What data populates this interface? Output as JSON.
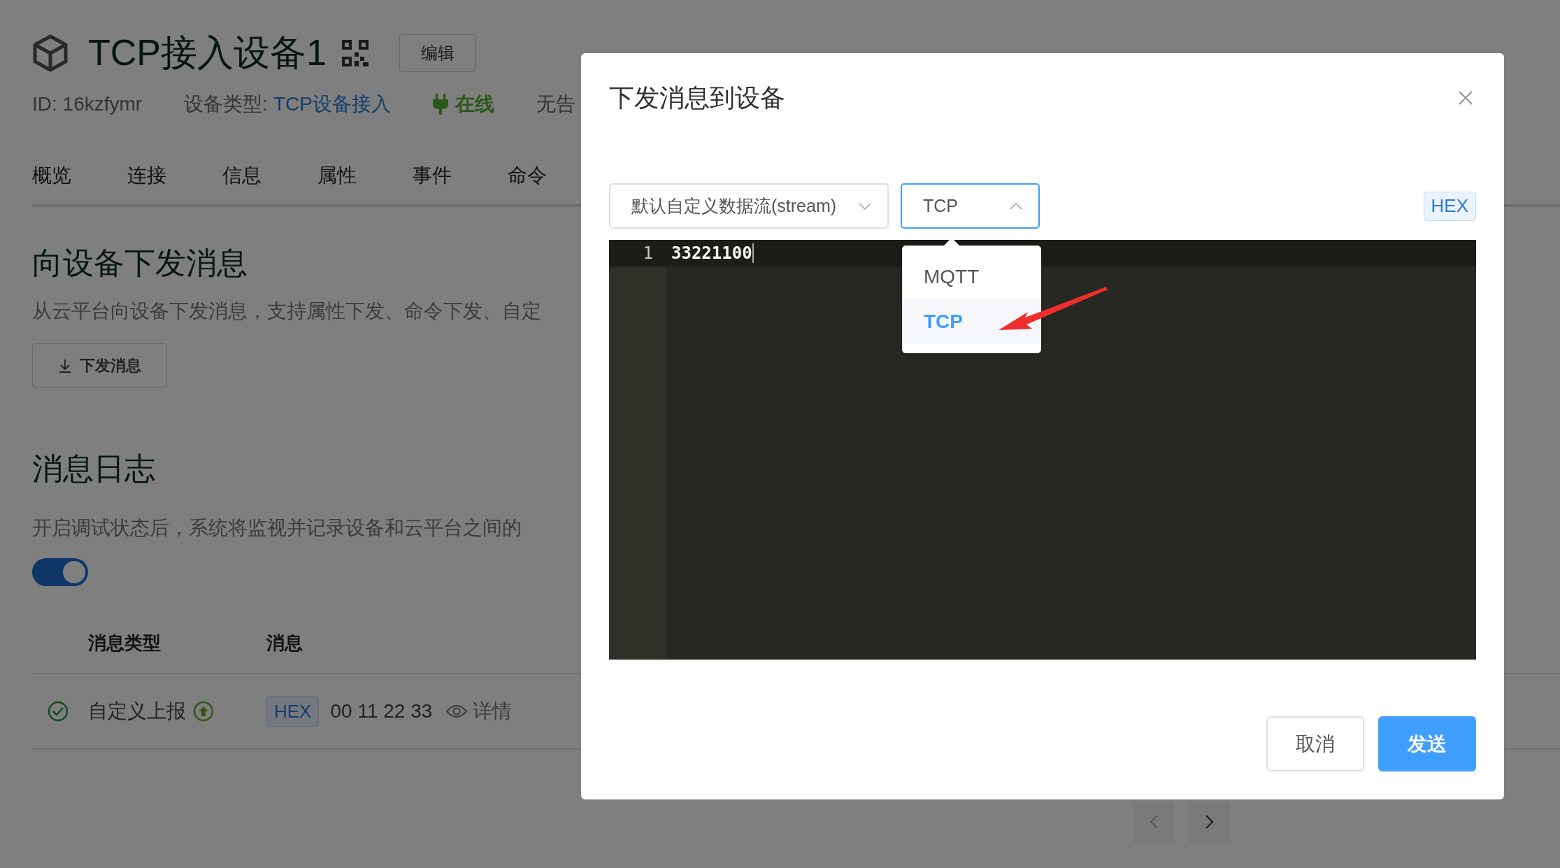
{
  "device": {
    "title": "TCP接入设备1",
    "edit_button": "编辑",
    "id_label": "ID: 16kzfymr",
    "type_label": "设备类型:",
    "type_value": "TCP设备接入",
    "status": "在线",
    "online": true,
    "alarm_label": "无告"
  },
  "tabs": [
    "概览",
    "连接",
    "信息",
    "属性",
    "事件",
    "命令"
  ],
  "send_section": {
    "heading": "向设备下发消息",
    "description": "从云平台向设备下发消息，支持属性下发、命令下发、自定",
    "button": "下发消息"
  },
  "log_section": {
    "heading": "消息日志",
    "description": "开启调试状态后，系统将监视并记录设备和云平台之间的",
    "debug_toggle": {
      "on": true
    }
  },
  "table": {
    "columns": [
      "消息类型",
      "消息"
    ],
    "rows": [
      {
        "success": true,
        "type": "自定义上报",
        "format": "HEX",
        "message": "00 11 22 33",
        "details": "详情"
      }
    ]
  },
  "modal": {
    "title": "下发消息到设备",
    "stream_select": {
      "value": "默认自定义数据流(stream)",
      "expanded": false
    },
    "protocol_select": {
      "value": "TCP",
      "expanded": true,
      "options": [
        {
          "label": "MQTT",
          "selected": false
        },
        {
          "label": "TCP",
          "selected": true
        }
      ]
    },
    "format_tag": "HEX",
    "editor_lines": [
      {
        "number": "1",
        "text": "33221100",
        "active": true
      }
    ],
    "buttons": [
      {
        "label": "取消",
        "kind": "default"
      },
      {
        "label": "发送",
        "kind": "primary"
      }
    ]
  }
}
